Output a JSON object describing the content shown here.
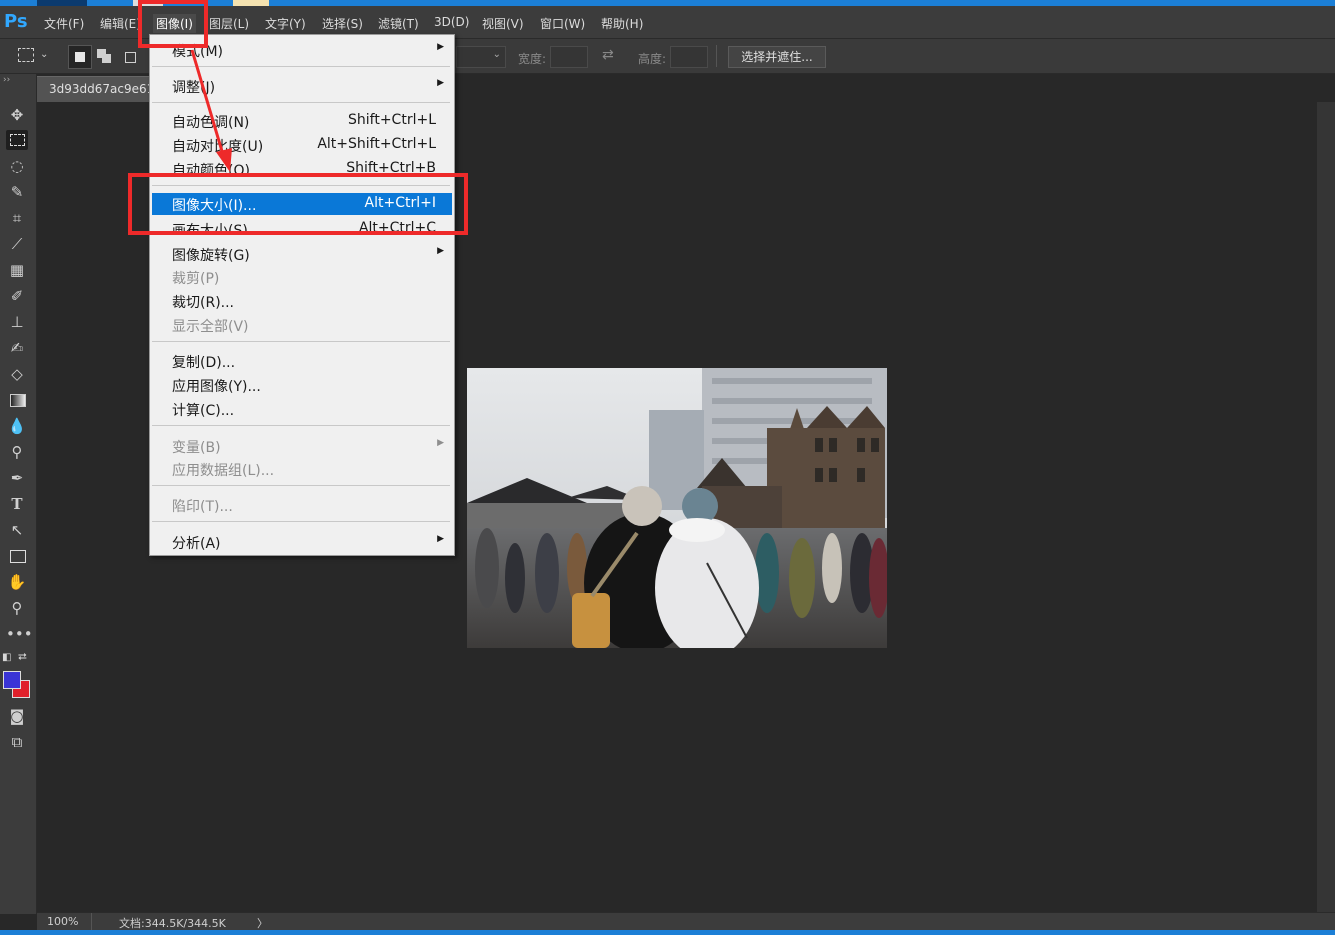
{
  "app": {
    "logo": "Ps"
  },
  "menubar": {
    "items": [
      "文件(F)",
      "编辑(E)",
      "图像(I)",
      "图层(L)",
      "文字(Y)",
      "选择(S)",
      "滤镜(T)",
      "3D(D)",
      "视图(V)",
      "窗口(W)",
      "帮助(H)"
    ],
    "active": "图像(I)"
  },
  "options_bar": {
    "width_label": "宽度:",
    "height_label": "高度:",
    "select_mask_button": "选择并遮住..."
  },
  "document": {
    "tab_title": "3d93dd67ac9e615"
  },
  "image_menu": {
    "items": [
      {
        "label": "模式(M)",
        "shortcut": "",
        "submenu": true,
        "disabled": false
      },
      {
        "label": "调整(J)",
        "shortcut": "",
        "submenu": true,
        "disabled": false
      },
      {
        "label": "自动色调(N)",
        "shortcut": "Shift+Ctrl+L",
        "submenu": false,
        "disabled": false
      },
      {
        "label": "自动对比度(U)",
        "shortcut": "Alt+Shift+Ctrl+L",
        "submenu": false,
        "disabled": false
      },
      {
        "label": "自动颜色(O)",
        "shortcut": "Shift+Ctrl+B",
        "submenu": false,
        "disabled": false
      },
      {
        "label": "图像大小(I)...",
        "shortcut": "Alt+Ctrl+I",
        "submenu": false,
        "disabled": false,
        "highlighted": true
      },
      {
        "label": "画布大小(S)...",
        "shortcut": "Alt+Ctrl+C",
        "submenu": false,
        "disabled": false
      },
      {
        "label": "图像旋转(G)",
        "shortcut": "",
        "submenu": true,
        "disabled": false
      },
      {
        "label": "裁剪(P)",
        "shortcut": "",
        "submenu": false,
        "disabled": true
      },
      {
        "label": "裁切(R)...",
        "shortcut": "",
        "submenu": false,
        "disabled": false
      },
      {
        "label": "显示全部(V)",
        "shortcut": "",
        "submenu": false,
        "disabled": true
      },
      {
        "label": "复制(D)...",
        "shortcut": "",
        "submenu": false,
        "disabled": false
      },
      {
        "label": "应用图像(Y)...",
        "shortcut": "",
        "submenu": false,
        "disabled": false
      },
      {
        "label": "计算(C)...",
        "shortcut": "",
        "submenu": false,
        "disabled": false
      },
      {
        "label": "变量(B)",
        "shortcut": "",
        "submenu": true,
        "disabled": true
      },
      {
        "label": "应用数据组(L)...",
        "shortcut": "",
        "submenu": false,
        "disabled": true
      },
      {
        "label": "陷印(T)...",
        "shortcut": "",
        "submenu": false,
        "disabled": true
      },
      {
        "label": "分析(A)",
        "shortcut": "",
        "submenu": true,
        "disabled": false
      }
    ]
  },
  "statusbar": {
    "zoom": "100%",
    "doc_info": "文档:344.5K/344.5K",
    "arrow": "〉"
  },
  "colors": {
    "foreground": "#3a34d6",
    "background": "#e0202a",
    "highlight": "#0a78d7",
    "annotation": "#ee2a2a"
  }
}
